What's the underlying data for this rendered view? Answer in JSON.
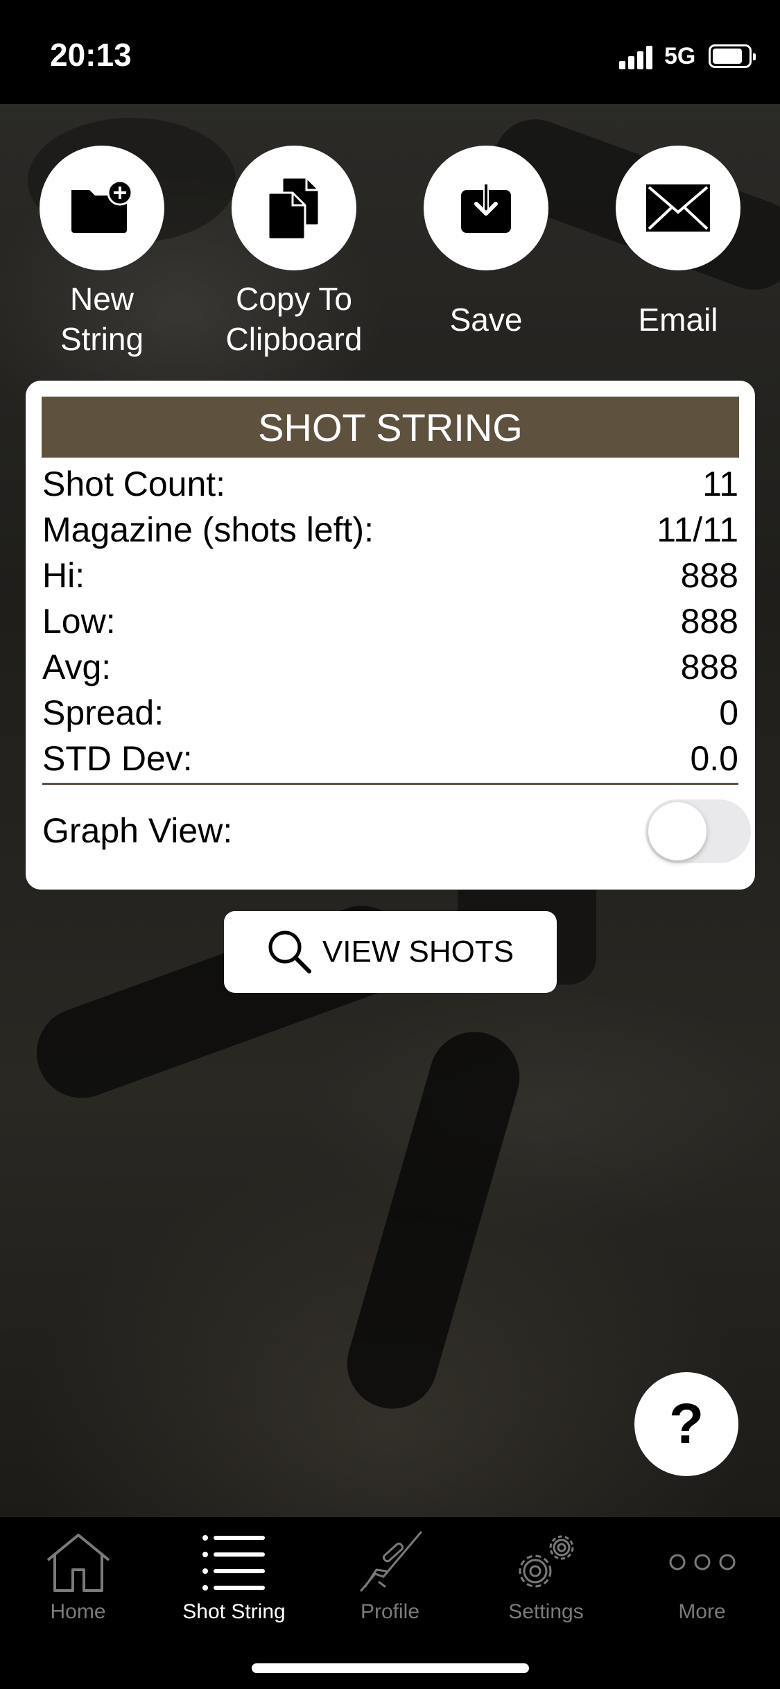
{
  "status_bar": {
    "time": "20:13",
    "network": "5G",
    "signal_bars": 4,
    "battery_level": 0.85
  },
  "actions": [
    {
      "label": "New\nString",
      "icon": "new-folder-icon"
    },
    {
      "label": "Copy To\nClipboard",
      "icon": "copy-icon"
    },
    {
      "label": "Save",
      "icon": "save-download-icon"
    },
    {
      "label": "Email",
      "icon": "envelope-icon"
    }
  ],
  "card": {
    "title": "SHOT STRING",
    "stats": [
      {
        "label": "Shot Count:",
        "value": "11"
      },
      {
        "label": "Magazine (shots left):",
        "value": "11/11"
      },
      {
        "label": "Hi:",
        "value": "888"
      },
      {
        "label": "Low:",
        "value": "888"
      },
      {
        "label": "Avg:",
        "value": "888"
      },
      {
        "label": "Spread:",
        "value": "0"
      },
      {
        "label": "STD Dev:",
        "value": "0.0"
      }
    ],
    "graph_view_label": "Graph View:",
    "graph_view_on": false
  },
  "view_shots_label": "VIEW SHOTS",
  "help_label": "?",
  "tabs": [
    {
      "label": "Home",
      "icon": "home-icon",
      "active": false
    },
    {
      "label": "Shot String",
      "icon": "list-icon",
      "active": true
    },
    {
      "label": "Profile",
      "icon": "rifle-icon",
      "active": false
    },
    {
      "label": "Settings",
      "icon": "gear-icon",
      "active": false
    },
    {
      "label": "More",
      "icon": "more-dots-icon",
      "active": false
    }
  ],
  "colors": {
    "header_bar": "#5e523f",
    "active_tab": "#ffffff",
    "inactive_tab": "#7a7a7a"
  }
}
